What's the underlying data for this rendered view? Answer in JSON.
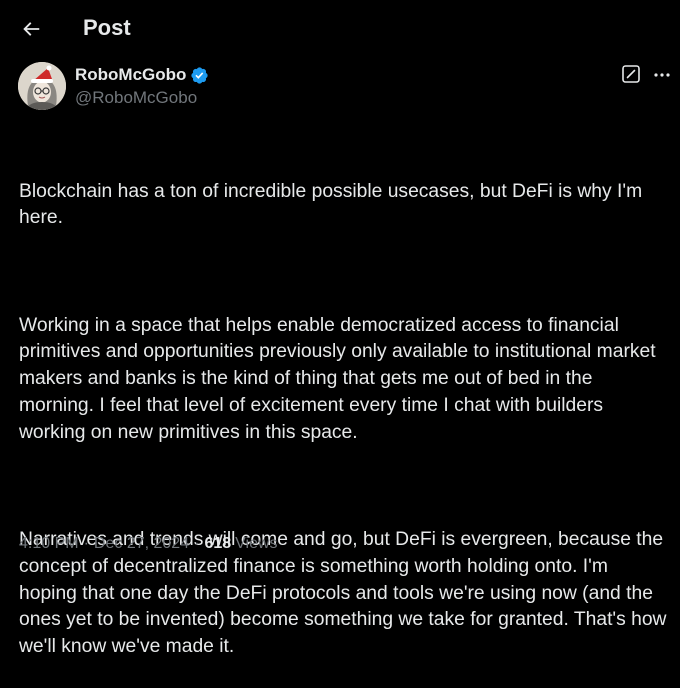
{
  "header": {
    "title": "Post",
    "back_icon": "arrow-left-icon"
  },
  "author": {
    "display_name": "RoboMcGobo",
    "handle": "@RoboMcGobo",
    "verified_icon": "verified-badge-icon",
    "verified_color": "#1d9bf0"
  },
  "actions": {
    "grok_icon": "grok-icon",
    "more_icon": "more-dots-icon"
  },
  "tweet": {
    "paragraphs": [
      "Blockchain has a ton of incredible possible usecases, but DeFi is why I'm here.",
      "Working in a space that helps enable democratized access to financial primitives and opportunities previously only available to institutional market makers and banks is the kind of thing that gets me out of bed in the morning. I feel that level of excitement every time I chat with builders working on new primitives in this space.",
      "Narratives and trends will come and go, but DeFi is evergreen, because the concept of decentralized finance is something worth holding onto. I'm hoping that one day the DeFi protocols and tools we're using now (and the ones yet to be invented) become something we take for granted. That's how we'll know we've made it."
    ]
  },
  "meta": {
    "time": "4:10 PM",
    "separator": "·",
    "date": "Dec 27, 2024",
    "views_count": "618",
    "views_label": "Views"
  },
  "colors": {
    "background": "#000000",
    "text_primary": "#e7e9ea",
    "text_secondary": "#71767b",
    "accent": "#1d9bf0"
  }
}
